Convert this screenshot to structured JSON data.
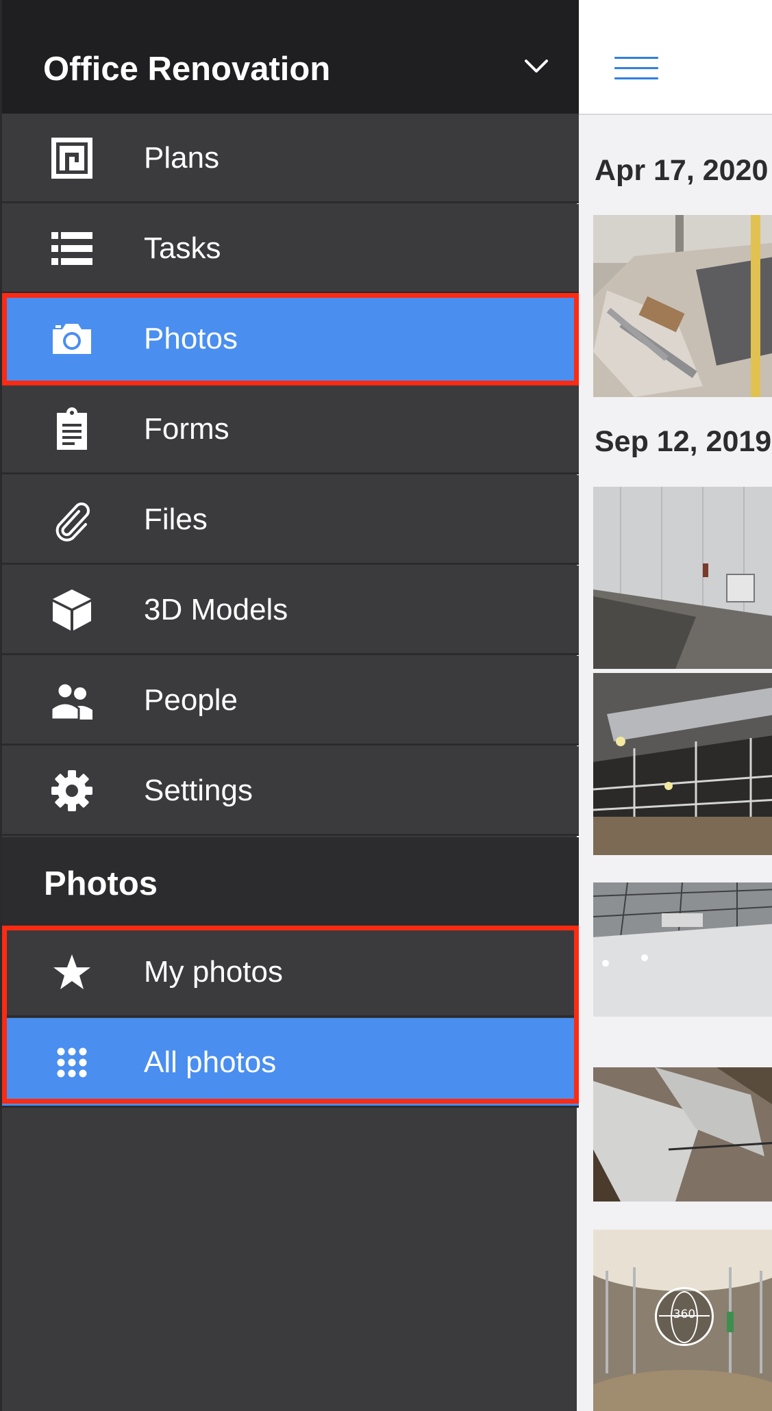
{
  "project": {
    "title": "Office Renovation"
  },
  "menu": [
    {
      "label": "Plans",
      "icon": "plans-icon",
      "active": false
    },
    {
      "label": "Tasks",
      "icon": "list-icon",
      "active": false
    },
    {
      "label": "Photos",
      "icon": "camera-icon",
      "active": true
    },
    {
      "label": "Forms",
      "icon": "clipboard-icon",
      "active": false
    },
    {
      "label": "Files",
      "icon": "paperclip-icon",
      "active": false
    },
    {
      "label": "3D Models",
      "icon": "cube-icon",
      "active": false
    },
    {
      "label": "People",
      "icon": "people-icon",
      "active": false
    },
    {
      "label": "Settings",
      "icon": "gear-icon",
      "active": false
    }
  ],
  "photos_section": {
    "title": "Photos",
    "items": [
      {
        "label": "My photos",
        "icon": "star-icon",
        "active": false
      },
      {
        "label": "All photos",
        "icon": "grid-dots-icon",
        "active": true
      }
    ]
  },
  "content": {
    "groups": [
      {
        "date": "Apr 17, 2020"
      },
      {
        "date": "Sep 12, 2019"
      }
    ],
    "badge_360": "360"
  },
  "colors": {
    "sidebar_bg": "#3b3b3e",
    "header_bg": "#1f1f21",
    "active_bg": "#4a8ef0",
    "highlight": "#ff2a12",
    "accent": "#2f7fe0"
  }
}
